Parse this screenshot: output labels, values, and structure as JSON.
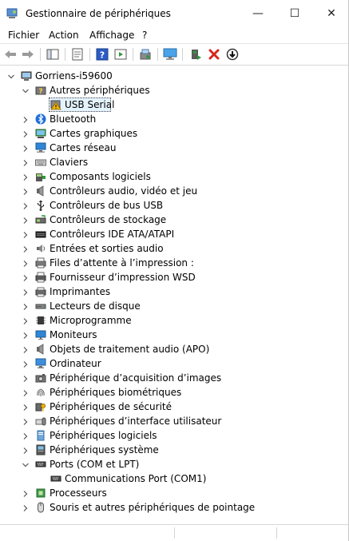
{
  "window": {
    "title": "Gestionnaire de périphériques"
  },
  "title_buttons": {
    "minimize": "—",
    "maximize": "☐",
    "close": "✕"
  },
  "menu": [
    "Fichier",
    "Action",
    "Affichage",
    "?"
  ],
  "toolbar": [
    "back-icon",
    "forward-icon",
    "show-hide-console-tree-icon",
    "properties-icon",
    "help-icon",
    "action-pane-icon",
    "scan-hardware-icon",
    "display-devices-icon",
    "add-driver-icon",
    "uninstall-device-icon",
    "disable-device-icon"
  ],
  "tree": {
    "root": "Gorriens-i59600",
    "items": [
      {
        "label": "Autres périphériques",
        "icon": "unknown-device-icon",
        "expanded": true,
        "children": [
          {
            "label": "USB Serial",
            "icon": "warning-device-icon",
            "selected": true
          }
        ]
      },
      {
        "label": "Bluetooth",
        "icon": "bluetooth-icon"
      },
      {
        "label": "Cartes graphiques",
        "icon": "display-adapter-icon"
      },
      {
        "label": "Cartes réseau",
        "icon": "network-adapter-icon"
      },
      {
        "label": "Claviers",
        "icon": "keyboard-icon"
      },
      {
        "label": "Composants logiciels",
        "icon": "software-component-icon"
      },
      {
        "label": "Contrôleurs audio, vidéo et jeu",
        "icon": "audio-icon"
      },
      {
        "label": "Contrôleurs de bus USB",
        "icon": "usb-icon"
      },
      {
        "label": "Contrôleurs de stockage",
        "icon": "storage-controller-icon"
      },
      {
        "label": "Contrôleurs IDE ATA/ATAPI",
        "icon": "ide-controller-icon"
      },
      {
        "label": "Entrées et sorties audio",
        "icon": "speaker-icon"
      },
      {
        "label": "Files d’attente à l’impression :",
        "icon": "print-queue-icon"
      },
      {
        "label": "Fournisseur d’impression WSD",
        "icon": "wsd-printer-icon"
      },
      {
        "label": "Imprimantes",
        "icon": "printer-icon"
      },
      {
        "label": "Lecteurs de disque",
        "icon": "disk-drive-icon"
      },
      {
        "label": "Microprogramme",
        "icon": "firmware-icon"
      },
      {
        "label": "Moniteurs",
        "icon": "monitor-icon"
      },
      {
        "label": "Objets de traitement audio (APO)",
        "icon": "audio-processing-icon"
      },
      {
        "label": "Ordinateur",
        "icon": "computer-icon"
      },
      {
        "label": "Périphérique d’acquisition d’images",
        "icon": "camera-icon"
      },
      {
        "label": "Périphériques biométriques",
        "icon": "fingerprint-icon"
      },
      {
        "label": "Périphériques de sécurité",
        "icon": "security-key-icon"
      },
      {
        "label": "Périphériques d’interface utilisateur",
        "icon": "hid-icon"
      },
      {
        "label": "Périphériques logiciels",
        "icon": "software-device-icon"
      },
      {
        "label": "Périphériques système",
        "icon": "system-device-icon"
      },
      {
        "label": "Ports (COM et LPT)",
        "icon": "port-icon",
        "expanded": true,
        "children": [
          {
            "label": "Communications Port (COM1)",
            "icon": "com-port-icon"
          }
        ]
      },
      {
        "label": "Processeurs",
        "icon": "processor-icon"
      },
      {
        "label": "Souris et autres périphériques de pointage",
        "icon": "mouse-icon"
      }
    ]
  },
  "colors": {
    "accent": "#1e6fd9",
    "selection": "#e5f3ff",
    "warning": "#f2b600",
    "error": "#d7261c",
    "green": "#2e9a3c"
  }
}
